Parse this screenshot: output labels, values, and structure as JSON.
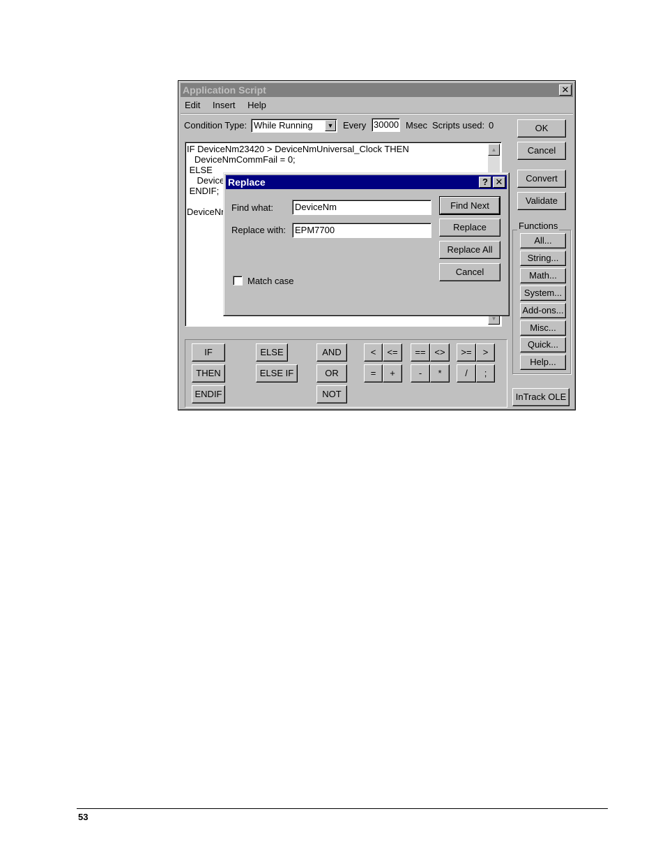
{
  "window": {
    "title": "Application Script",
    "menu": [
      "Edit",
      "Insert",
      "Help"
    ],
    "condition_label": "Condition Type:",
    "condition_value": "While Running",
    "every_label": "Every",
    "every_value": "30000",
    "msec_label": "Msec",
    "scripts_used_label": "Scripts used:",
    "scripts_used_value": "0",
    "script_lines": [
      "IF DeviceNm23420 > DeviceNmUniversal_Clock THEN",
      "   DeviceNmCommFail = 0;",
      " ELSE",
      "    Device",
      " ENDIF;",
      "",
      "DeviceNr"
    ],
    "right_buttons": [
      "OK",
      "Cancel",
      "Convert",
      "Validate"
    ],
    "functions_label": "Functions",
    "function_buttons": [
      "All...",
      "String...",
      "Math...",
      "System...",
      "Add-ons...",
      "Misc...",
      "Quick...",
      "Help..."
    ],
    "intrack_button": "InTrack OLE",
    "keywords": {
      "if": "IF",
      "then": "THEN",
      "endif": "ENDIF",
      "else": "ELSE",
      "elseif": "ELSE IF",
      "and": "AND",
      "or": "OR",
      "not": "NOT",
      "lt": "<",
      "le": "<=",
      "eq": "==",
      "ne": "<>",
      "ge": ">=",
      "gt": ">",
      "assign": "=",
      "plus": "+",
      "minus": "-",
      "mult": "*",
      "div": "/",
      "semi": ";"
    }
  },
  "replace_dialog": {
    "title": "Replace",
    "help_glyph": "?",
    "close_glyph": "✕",
    "find_label": "Find what:",
    "find_value": "DeviceNm",
    "replace_label": "Replace with:",
    "replace_value": "EPM7700",
    "match_case_label": "Match case",
    "match_case_checked": false,
    "buttons": [
      "Find Next",
      "Replace",
      "Replace All",
      "Cancel"
    ]
  },
  "footer": {
    "page_number": "53"
  }
}
